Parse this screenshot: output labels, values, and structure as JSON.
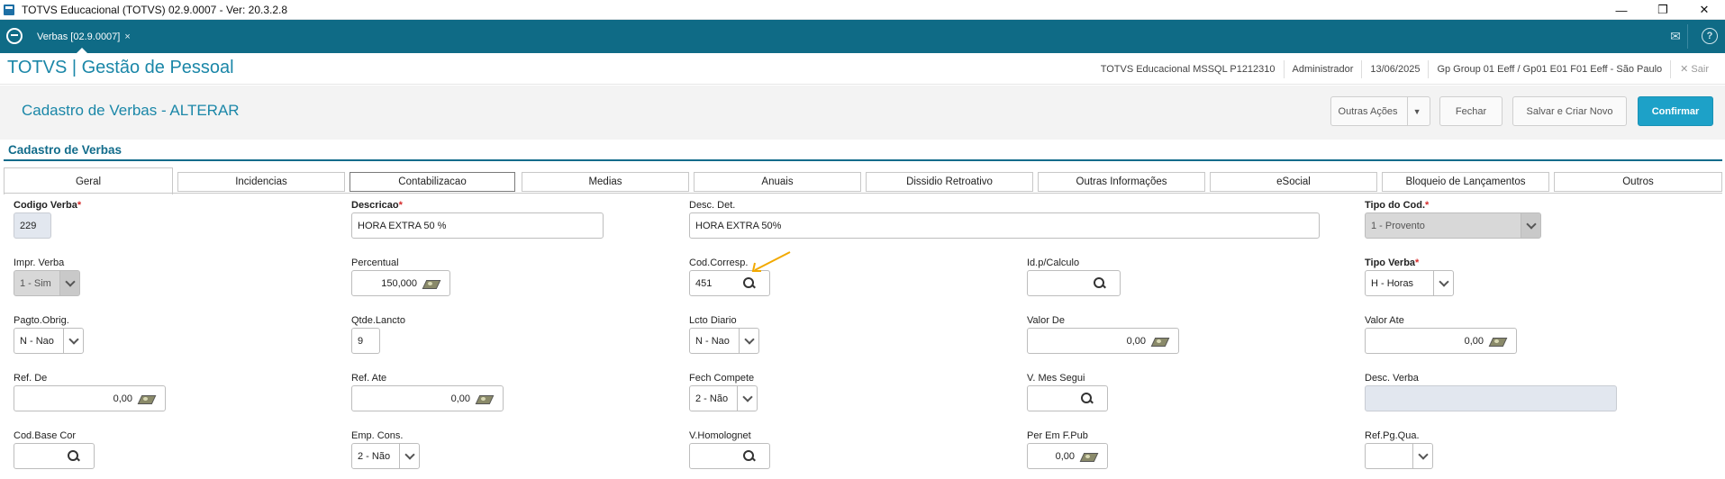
{
  "window": {
    "title": "TOTVS Educacional (TOTVS) 02.9.0007 - Ver: 20.3.2.8",
    "controls": [
      "—",
      "❐",
      "✕"
    ]
  },
  "tabbar": {
    "tab_label": "Verbas [02.9.0007]",
    "tab_close": "×",
    "mail_icon": "✉",
    "help_icon": "?"
  },
  "product": {
    "brand": "TOTVS | Gestão de Pessoal",
    "info": [
      "TOTVS Educacional MSSQL P1212310",
      "Administrador",
      "13/06/2025",
      "Gp Group 01 Eeff / Gp01 E01 F01 Eeff - São Paulo"
    ],
    "exit": "✕  Sair"
  },
  "page": {
    "title": "Cadastro de Verbas - ALTERAR",
    "buttons": {
      "outras_acoes": "Outras Ações",
      "fechar": "Fechar",
      "salvar_criar": "Salvar e Criar Novo",
      "confirmar": "Confirmar"
    }
  },
  "section": {
    "title": "Cadastro de Verbas"
  },
  "tabs": [
    "Geral",
    "Incidencias",
    "Contabilizacao",
    "Medias",
    "Anuais",
    "Dissidio Retroativo",
    "Outras Informações",
    "eSocial",
    "Bloqueio de Lançamentos",
    "Outros"
  ],
  "fields": {
    "codigo_verba": {
      "label": "Codigo Verba",
      "required": "*",
      "value": "229"
    },
    "descricao": {
      "label": "Descricao",
      "required": "*",
      "value": "HORA EXTRA 50 %"
    },
    "desc_det": {
      "label": "Desc. Det.",
      "value": "HORA EXTRA 50%"
    },
    "tipo_cod": {
      "label": "Tipo do Cod.",
      "required": "*",
      "value": "1 - Provento"
    },
    "impr_verba": {
      "label": "Impr. Verba",
      "value": "1 - Sim"
    },
    "percentual": {
      "label": "Percentual",
      "value": "150,000"
    },
    "cod_corresp": {
      "label": "Cod.Corresp.",
      "value": "451"
    },
    "id_calculo": {
      "label": "Id.p/Calculo",
      "value": ""
    },
    "tipo_verba": {
      "label": "Tipo Verba",
      "required": "*",
      "value": "H - Horas"
    },
    "pagto_obrig": {
      "label": "Pagto.Obrig.",
      "value": "N - Nao"
    },
    "qtde_lancto": {
      "label": "Qtde.Lancto",
      "value": "9"
    },
    "lcto_diario": {
      "label": "Lcto Diario",
      "value": "N - Nao"
    },
    "valor_de": {
      "label": "Valor De",
      "value": "0,00"
    },
    "valor_ate": {
      "label": "Valor Ate",
      "value": "0,00"
    },
    "ref_de": {
      "label": "Ref. De",
      "value": "0,00"
    },
    "ref_ate": {
      "label": "Ref. Ate",
      "value": "0,00"
    },
    "fech_compete": {
      "label": "Fech Compete",
      "value": "2 - Não"
    },
    "v_mes_segui": {
      "label": "V. Mes Segui",
      "value": ""
    },
    "desc_verba": {
      "label": "Desc. Verba",
      "value": ""
    },
    "cod_base_cor": {
      "label": "Cod.Base Cor",
      "value": ""
    },
    "emp_cons": {
      "label": "Emp. Cons.",
      "value": "2 - Não"
    },
    "v_homolognet": {
      "label": "V.Homolognet",
      "value": ""
    },
    "per_em_fpub": {
      "label": "Per Em F.Pub",
      "value": "0,00"
    },
    "ref_pg_qua": {
      "label": "Ref.Pg.Qua.",
      "value": ""
    }
  },
  "colors": {
    "header_bg": "#0f6b86",
    "brand": "#1b87a8",
    "primary_button": "#1da1c8",
    "required": "#d52b2b",
    "annotation_arrow": "#f2a900"
  }
}
